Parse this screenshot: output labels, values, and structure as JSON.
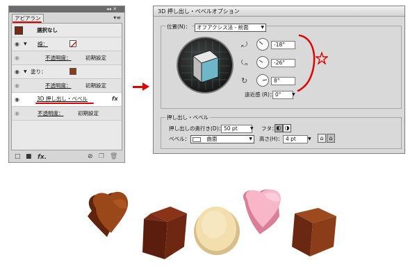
{
  "appearance_panel": {
    "tab_label": "アピアランス",
    "top_controls": "◂◂ ✕",
    "menu_icon": "panel-menu-icon",
    "header": {
      "title": "選択なし"
    },
    "rows": [
      {
        "label": "線：",
        "opacity_label": "不透明度：",
        "opacity_value": "初期設定"
      },
      {
        "label": "塗り：",
        "opacity_label": "不透明度：",
        "opacity_value": "初期設定"
      },
      {
        "label": "3D 押し出し・ベベル",
        "fx": "fx"
      },
      {
        "opacity_label": "不透明度：",
        "opacity_value": "初期設定"
      }
    ],
    "bottom_fx": "fx."
  },
  "dialog": {
    "title": "3D 押し出し・ベベルオプション",
    "position_label": "位置(N)：",
    "position_value": "オフアクシス法 - 前面",
    "rotation_x": "-18°",
    "rotation_y": "-26°",
    "rotation_z": "8°",
    "perspective_label": "遠近感 (R)：",
    "perspective_value": "0°",
    "extrude_group_label": "押し出し・ベベル",
    "depth_label": "押し出しの奥行き(D)：",
    "depth_value": "50 pt",
    "cap_label": "フタ：",
    "bevel_label": "ベベル：",
    "bevel_value": "曲面",
    "height_label": "高さ(H)：",
    "height_value": "4 pt"
  },
  "colors": {
    "annotation_red": "#e00000",
    "cube_face": "#6eb6c8",
    "chocolate_brown": "#8a3d17",
    "dark_chocolate": "#6a2512",
    "white_chocolate": "#f1dcaa",
    "strawberry": "#f4a9bd"
  }
}
